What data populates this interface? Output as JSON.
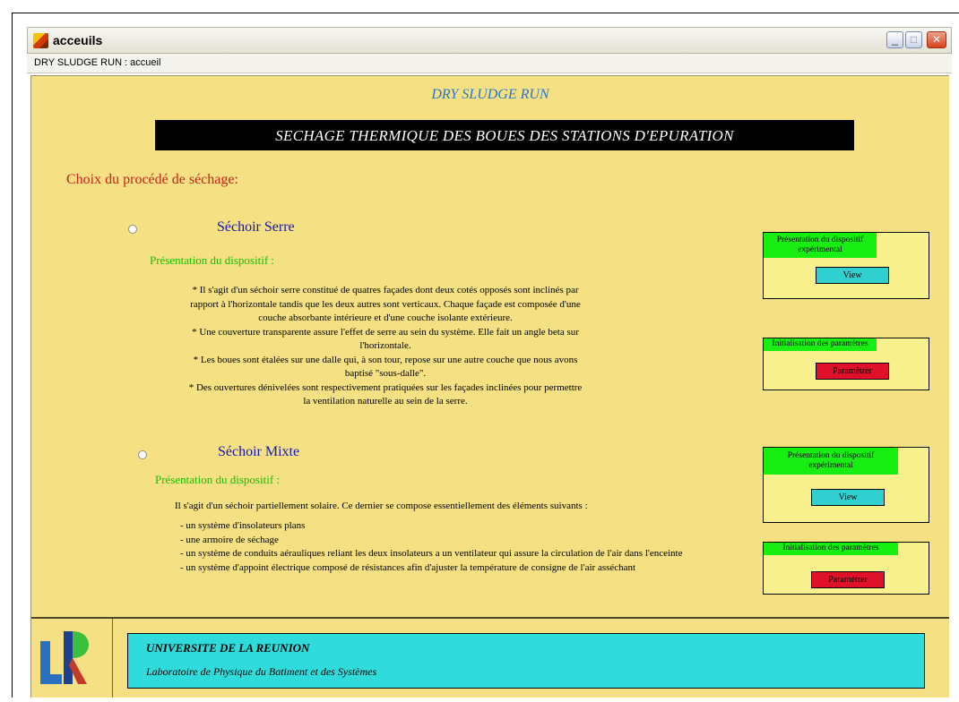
{
  "window": {
    "title": "acceuils",
    "breadcrumb": "DRY SLUDGE RUN : accueil",
    "min_glyph": "_",
    "max_glyph": "□",
    "close_glyph": "✕"
  },
  "header": {
    "app_title": "DRY SLUDGE RUN",
    "banner": "SECHAGE THERMIQUE DES BOUES DES STATIONS D'EPURATION"
  },
  "choice_heading": "Choix du procédé de séchage:",
  "options": [
    {
      "title": "Séchoir Serre",
      "presentation_label": "Présentation du dispositif :",
      "description_lines": [
        "* Il s'agit d'un séchoir serre constitué de quatres façades dont deux cotés opposés sont inclinés par",
        "rapport à l'horizontale tandis que les deux autres sont verticaux. Chaque façade est composée d'une",
        "couche absorbante intérieure et d'une couche isolante extérieure.",
        "* Une couverture transparente assure l'effet de serre au sein du système. Elle fait un angle beta sur",
        "l'horizontale.",
        "* Les boues sont étalées sur une dalle qui, à son tour, repose sur une autre couche que nous avons",
        "baptisé \"sous-dalle\".",
        "* Des ouvertures dénivelées sont respectivement pratiquées sur les façades inclinées pour permettre",
        "la ventilation naturelle au sein de la serre."
      ],
      "boxes": {
        "presentation_label": "Présentation du dispositif expérimental",
        "view_button": "View",
        "init_label": "Initialisation des paramètres",
        "param_button": "Paramètrer"
      }
    },
    {
      "title": "Séchoir Mixte",
      "presentation_label": "Présentation du dispositif :",
      "intro": "Il s'agit d'un séchoir partiellement solaire. Ce dernier se compose essentiellement des éléments suivants :",
      "items": [
        "- un système d'insolateurs plans",
        "- une armoire de séchage",
        "- un système de conduits aérauliques reliant les deux insolateurs a un ventilateur qui assure la circulation de l'air dans l'enceinte",
        "- un système d'appoint électrique composé de résistances afin d'ajuster la température de consigne de l'air asséchant"
      ],
      "boxes": {
        "presentation_label": "Présentation du dispositif expérimental",
        "view_button": "View",
        "init_label": "Initialisation des paramètres",
        "param_button": "Paramètrer"
      }
    }
  ],
  "footer": {
    "university": "UNIVERSITE DE LA REUNION",
    "laboratory": "Laboratoire de Physique du Batiment et des Systèmes"
  },
  "colors": {
    "panel_background": "#f5e183",
    "title_blue": "#2a76c9",
    "heading_red": "#c8231b",
    "option_title_blue": "#1616b0",
    "label_green": "#13c000",
    "box_label_green": "#19ee12",
    "view_button_cyan": "#30d0d0",
    "param_button_red": "#e0102a",
    "footer_cyan": "#2fdcdb"
  }
}
